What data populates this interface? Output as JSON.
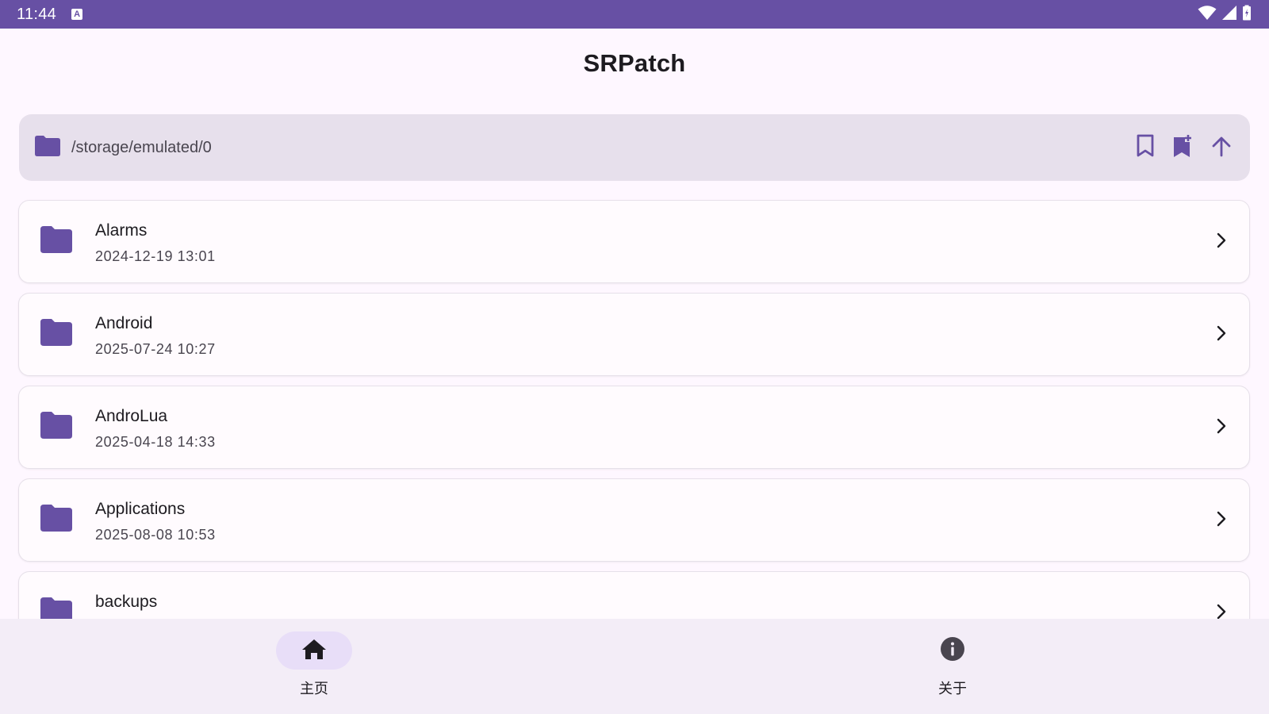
{
  "status_bar": {
    "time": "11:44",
    "keyboard_badge": "A",
    "icons": [
      "wifi-icon",
      "signal-icon",
      "battery-icon"
    ]
  },
  "app": {
    "title": "SRPatch"
  },
  "path_bar": {
    "path": "/storage/emulated/0",
    "actions": [
      "bookmark-icon",
      "bookmark-add-icon",
      "arrow-up-icon"
    ]
  },
  "files": [
    {
      "name": "Alarms",
      "date": "2024-12-19 13:01"
    },
    {
      "name": "Android",
      "date": "2025-07-24 10:27"
    },
    {
      "name": "AndroLua",
      "date": "2025-04-18 14:33"
    },
    {
      "name": "Applications",
      "date": "2025-08-08 10:53"
    },
    {
      "name": "backups",
      "date": ""
    }
  ],
  "nav": {
    "items": [
      {
        "label": "主页",
        "icon": "home-icon",
        "active": true
      },
      {
        "label": "关于",
        "icon": "info-icon",
        "active": false
      }
    ]
  },
  "colors": {
    "primary": "#6750a4",
    "background": "#fef7ff",
    "path_bar": "#e7e0ec",
    "nav_bar": "#f3edf7",
    "nav_active_pill": "#e8def8"
  }
}
